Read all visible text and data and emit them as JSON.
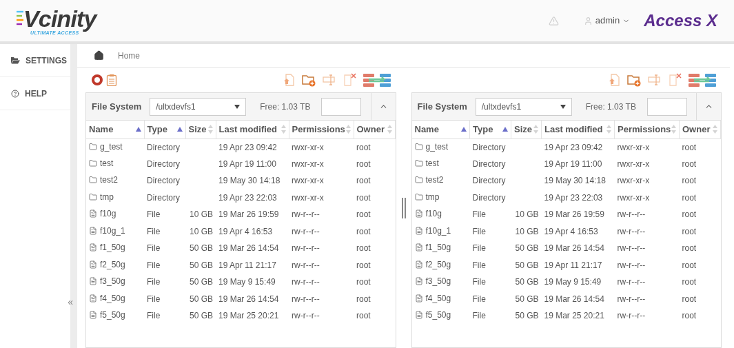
{
  "header": {
    "logo": "Vcinity",
    "tagline": "ULTIMATE ACCESS",
    "user": "admin",
    "product": "Access X"
  },
  "sidebar": {
    "items": [
      {
        "kind": "settings",
        "label": "SETTINGS"
      },
      {
        "kind": "help",
        "label": "HELP"
      }
    ],
    "collapse": "«"
  },
  "breadcrumb": [
    "Home"
  ],
  "panes": [
    {
      "fs_label": "File System",
      "path": "/ultxdevfs1",
      "free": "Free: 1.03 TB",
      "columns": [
        {
          "label": "Name",
          "sorted": true
        },
        {
          "label": "Type",
          "sorted": true
        },
        {
          "label": "Size",
          "sorted": false
        },
        {
          "label": "Last modified",
          "sorted": false
        },
        {
          "label": "Permissions",
          "sorted": false
        },
        {
          "label": "Owner",
          "sorted": false
        }
      ],
      "rows": [
        {
          "kind": "directory",
          "name": "g_test",
          "type": "Directory",
          "modified": "19 Apr 23 09:42",
          "permissions": "rwxr-xr-x",
          "owner": "root"
        },
        {
          "kind": "directory",
          "name": "test",
          "type": "Directory",
          "modified": "19 Apr 19 11:00",
          "permissions": "rwxr-xr-x",
          "owner": "root"
        },
        {
          "kind": "directory",
          "name": "test2",
          "type": "Directory",
          "modified": "19 May 30 14:18",
          "permissions": "rwxr-xr-x",
          "owner": "root"
        },
        {
          "kind": "directory",
          "name": "tmp",
          "type": "Directory",
          "modified": "19 Apr 23 22:03",
          "permissions": "rwxr-xr-x",
          "owner": "root"
        },
        {
          "kind": "file",
          "name": "f10g",
          "type": "File",
          "size": "10 GB",
          "modified": "19 Mar 26 19:59",
          "permissions": "rw-r--r--",
          "owner": "root"
        },
        {
          "kind": "file",
          "name": "f10g_1",
          "type": "File",
          "size": "10 GB",
          "modified": "19 Apr 4 16:53",
          "permissions": "rw-r--r--",
          "owner": "root"
        },
        {
          "kind": "file",
          "name": "f1_50g",
          "type": "File",
          "size": "50 GB",
          "modified": "19 Mar 26 14:54",
          "permissions": "rw-r--r--",
          "owner": "root"
        },
        {
          "kind": "file",
          "name": "f2_50g",
          "type": "File",
          "size": "50 GB",
          "modified": "19 Apr 11 21:17",
          "permissions": "rw-r--r--",
          "owner": "root"
        },
        {
          "kind": "file",
          "name": "f3_50g",
          "type": "File",
          "size": "50 GB",
          "modified": "19 May 9 15:49",
          "permissions": "rw-r--r--",
          "owner": "root"
        },
        {
          "kind": "file",
          "name": "f4_50g",
          "type": "File",
          "size": "50 GB",
          "modified": "19 Mar 26 14:54",
          "permissions": "rw-r--r--",
          "owner": "root"
        },
        {
          "kind": "file",
          "name": "f5_50g",
          "type": "File",
          "size": "50 GB",
          "modified": "19 Mar 25 20:21",
          "permissions": "rw-r--r--",
          "owner": "root"
        }
      ]
    },
    {
      "fs_label": "File System",
      "path": "/ultxdevfs1",
      "free": "Free: 1.03 TB",
      "columns": [
        {
          "label": "Name",
          "sorted": true
        },
        {
          "label": "Type",
          "sorted": true
        },
        {
          "label": "Size",
          "sorted": false
        },
        {
          "label": "Last modified",
          "sorted": false
        },
        {
          "label": "Permissions",
          "sorted": false
        },
        {
          "label": "Owner",
          "sorted": false
        }
      ],
      "rows": [
        {
          "kind": "directory",
          "name": "g_test",
          "type": "Directory",
          "modified": "19 Apr 23 09:42",
          "permissions": "rwxr-xr-x",
          "owner": "root"
        },
        {
          "kind": "directory",
          "name": "test",
          "type": "Directory",
          "modified": "19 Apr 19 11:00",
          "permissions": "rwxr-xr-x",
          "owner": "root"
        },
        {
          "kind": "directory",
          "name": "test2",
          "type": "Directory",
          "modified": "19 May 30 14:18",
          "permissions": "rwxr-xr-x",
          "owner": "root"
        },
        {
          "kind": "directory",
          "name": "tmp",
          "type": "Directory",
          "modified": "19 Apr 23 22:03",
          "permissions": "rwxr-xr-x",
          "owner": "root"
        },
        {
          "kind": "file",
          "name": "f10g",
          "type": "File",
          "size": "10 GB",
          "modified": "19 Mar 26 19:59",
          "permissions": "rw-r--r--",
          "owner": "root"
        },
        {
          "kind": "file",
          "name": "f10g_1",
          "type": "File",
          "size": "10 GB",
          "modified": "19 Apr 4 16:53",
          "permissions": "rw-r--r--",
          "owner": "root"
        },
        {
          "kind": "file",
          "name": "f1_50g",
          "type": "File",
          "size": "50 GB",
          "modified": "19 Mar 26 14:54",
          "permissions": "rw-r--r--",
          "owner": "root"
        },
        {
          "kind": "file",
          "name": "f2_50g",
          "type": "File",
          "size": "50 GB",
          "modified": "19 Apr 11 21:17",
          "permissions": "rw-r--r--",
          "owner": "root"
        },
        {
          "kind": "file",
          "name": "f3_50g",
          "type": "File",
          "size": "50 GB",
          "modified": "19 May 9 15:49",
          "permissions": "rw-r--r--",
          "owner": "root"
        },
        {
          "kind": "file",
          "name": "f4_50g",
          "type": "File",
          "size": "50 GB",
          "modified": "19 Mar 26 14:54",
          "permissions": "rw-r--r--",
          "owner": "root"
        },
        {
          "kind": "file",
          "name": "f5_50g",
          "type": "File",
          "size": "50 GB",
          "modified": "19 Mar 25 20:21",
          "permissions": "rw-r--r--",
          "owner": "root"
        }
      ]
    }
  ]
}
